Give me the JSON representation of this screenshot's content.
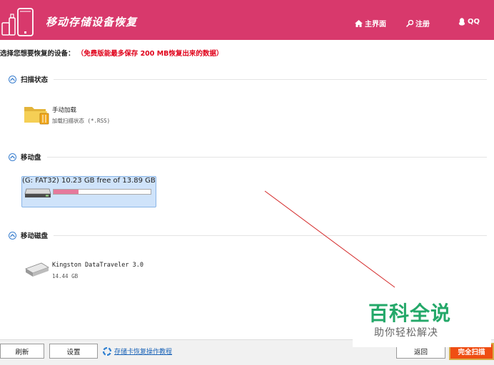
{
  "header": {
    "title": "移动存储设备恢复",
    "nav_home": "主界面",
    "nav_register": "注册",
    "nav_qq": "QQ",
    "bg_color": "#d8396c"
  },
  "notice": {
    "prompt": "选择您想要恢复的设备：",
    "limit": "（免费版能最多保存 200 MB恢复出来的数据）"
  },
  "sections": [
    {
      "title": "扫描状态",
      "devices": [
        {
          "name": "手动加载",
          "sub": "加载扫描状态 (*.RSS)",
          "icon": "folder-icon"
        }
      ]
    },
    {
      "title": "移动盘",
      "devices": [
        {
          "name": "(G: FAT32)",
          "sub": "10.23 GB free of 13.89 GB",
          "icon": "drive-icon",
          "used_fraction": 0.26,
          "selected": true
        }
      ]
    },
    {
      "title": "移动磁盘",
      "devices": [
        {
          "name": "Kingston DataTraveler 3.0",
          "sub": "14.44 GB",
          "icon": "usb-drive-icon"
        }
      ]
    }
  ],
  "footer": {
    "refresh": "刷新",
    "settings": "设置",
    "tutorial": "存储卡恢复操作教程",
    "back": "返回",
    "full_scan": "完全扫描"
  },
  "watermark": {
    "title": "百科全说",
    "subtitle": "助你轻松解决"
  },
  "colors": {
    "accent": "#d8396c",
    "scan_button": "#ef4e13",
    "selection": "#cfe3fa",
    "annotation_arrow": "#d42a2a"
  }
}
